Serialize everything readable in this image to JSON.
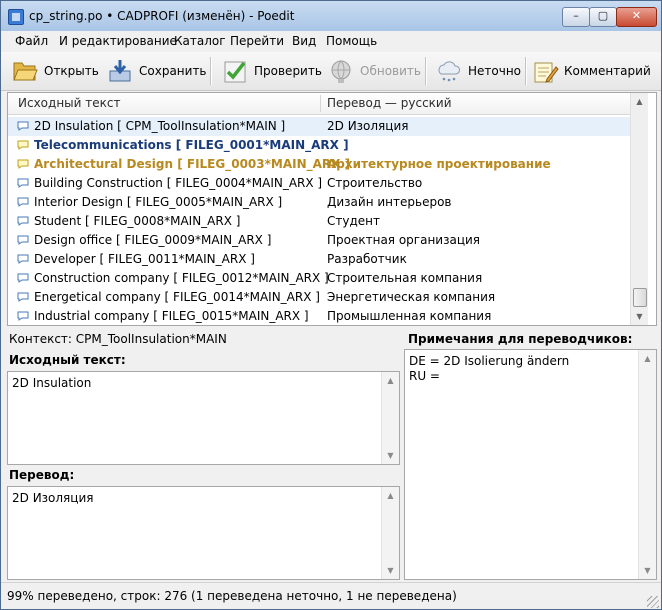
{
  "window": {
    "title": "cp_string.po • CADPROFI (изменён) - Poedit",
    "minimize_label": "–",
    "maximize_label": "▢",
    "close_label": "✕",
    "app_icon": "poedit-app-icon"
  },
  "menu": [
    "Файл",
    "И редактирование",
    "Каталог",
    "Перейти",
    "Вид",
    "Помощь"
  ],
  "toolbar": {
    "open": {
      "label": "Открыть",
      "icon": "folder-open-icon"
    },
    "save": {
      "label": "Сохранить",
      "icon": "save-icon"
    },
    "validate": {
      "label": "Проверить",
      "icon": "checkmark-icon"
    },
    "update": {
      "label": "Обновить",
      "icon": "globe-update-icon",
      "disabled": true
    },
    "fuzzy": {
      "label": "Неточно",
      "icon": "cloud-fuzzy-icon"
    },
    "comment": {
      "label": "Комментарий",
      "icon": "notepad-comment-icon"
    }
  },
  "list": {
    "columns": {
      "source": "Исходный текст",
      "translation": "Перевод — русский"
    },
    "rows": [
      {
        "source": "2D Insulation  [ CPM_ToolInsulation*MAIN ]",
        "translation": "2D Изоляция",
        "state": "selected"
      },
      {
        "source": "Telecommunications  [ FILEG_0001*MAIN_ARX ]",
        "translation": "",
        "state": "untranslated"
      },
      {
        "source": "Architectural Design  [ FILEG_0003*MAIN_ARX ]",
        "translation": "Архитектурное проектирование",
        "state": "fuzzy"
      },
      {
        "source": "Building Construction  [ FILEG_0004*MAIN_ARX ]",
        "translation": "Строительство",
        "state": "normal"
      },
      {
        "source": "Interior Design  [ FILEG_0005*MAIN_ARX ]",
        "translation": "Дизайн интерьеров",
        "state": "normal"
      },
      {
        "source": "Student  [ FILEG_0008*MAIN_ARX ]",
        "translation": "Студент",
        "state": "normal"
      },
      {
        "source": "Design office  [ FILEG_0009*MAIN_ARX ]",
        "translation": "Проектная организация",
        "state": "normal"
      },
      {
        "source": "Developer  [ FILEG_0011*MAIN_ARX ]",
        "translation": "Разработчик",
        "state": "normal"
      },
      {
        "source": "Construction company  [ FILEG_0012*MAIN_ARX ]",
        "translation": "Строительная компания",
        "state": "normal"
      },
      {
        "source": "Energetical company  [ FILEG_0014*MAIN_ARX ]",
        "translation": "Энергетическая компания",
        "state": "normal"
      },
      {
        "source": "Industrial company  [ FILEG_0015*MAIN_ARX ]",
        "translation": "Промышленная компания",
        "state": "normal"
      }
    ]
  },
  "editor": {
    "context": "Контекст: CPM_ToolInsulation*MAIN",
    "source_label": "Исходный текст:",
    "source_text": "2D Insulation",
    "translation_label": "Перевод:",
    "translation_text": "2D Изоляция",
    "notes_label": "Примечания для переводчиков:",
    "notes_text": "DE = 2D Isolierung ändern\nRU ="
  },
  "status": "99% переведено, строк: 276 (1 переведена неточно, 1 не переведена)",
  "colors": {
    "untranslated": "#1a3c7a",
    "fuzzy": "#b8891f",
    "selected_row": "#e5f0fb"
  }
}
